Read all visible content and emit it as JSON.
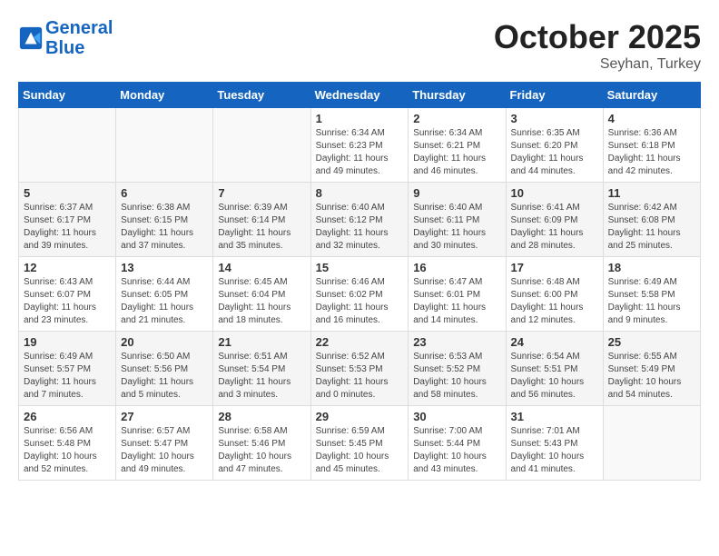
{
  "header": {
    "logo_line1": "General",
    "logo_line2": "Blue",
    "month_title": "October 2025",
    "location": "Seyhan, Turkey"
  },
  "weekdays": [
    "Sunday",
    "Monday",
    "Tuesday",
    "Wednesday",
    "Thursday",
    "Friday",
    "Saturday"
  ],
  "weeks": [
    [
      {
        "day": "",
        "info": ""
      },
      {
        "day": "",
        "info": ""
      },
      {
        "day": "",
        "info": ""
      },
      {
        "day": "1",
        "info": "Sunrise: 6:34 AM\nSunset: 6:23 PM\nDaylight: 11 hours\nand 49 minutes."
      },
      {
        "day": "2",
        "info": "Sunrise: 6:34 AM\nSunset: 6:21 PM\nDaylight: 11 hours\nand 46 minutes."
      },
      {
        "day": "3",
        "info": "Sunrise: 6:35 AM\nSunset: 6:20 PM\nDaylight: 11 hours\nand 44 minutes."
      },
      {
        "day": "4",
        "info": "Sunrise: 6:36 AM\nSunset: 6:18 PM\nDaylight: 11 hours\nand 42 minutes."
      }
    ],
    [
      {
        "day": "5",
        "info": "Sunrise: 6:37 AM\nSunset: 6:17 PM\nDaylight: 11 hours\nand 39 minutes."
      },
      {
        "day": "6",
        "info": "Sunrise: 6:38 AM\nSunset: 6:15 PM\nDaylight: 11 hours\nand 37 minutes."
      },
      {
        "day": "7",
        "info": "Sunrise: 6:39 AM\nSunset: 6:14 PM\nDaylight: 11 hours\nand 35 minutes."
      },
      {
        "day": "8",
        "info": "Sunrise: 6:40 AM\nSunset: 6:12 PM\nDaylight: 11 hours\nand 32 minutes."
      },
      {
        "day": "9",
        "info": "Sunrise: 6:40 AM\nSunset: 6:11 PM\nDaylight: 11 hours\nand 30 minutes."
      },
      {
        "day": "10",
        "info": "Sunrise: 6:41 AM\nSunset: 6:09 PM\nDaylight: 11 hours\nand 28 minutes."
      },
      {
        "day": "11",
        "info": "Sunrise: 6:42 AM\nSunset: 6:08 PM\nDaylight: 11 hours\nand 25 minutes."
      }
    ],
    [
      {
        "day": "12",
        "info": "Sunrise: 6:43 AM\nSunset: 6:07 PM\nDaylight: 11 hours\nand 23 minutes."
      },
      {
        "day": "13",
        "info": "Sunrise: 6:44 AM\nSunset: 6:05 PM\nDaylight: 11 hours\nand 21 minutes."
      },
      {
        "day": "14",
        "info": "Sunrise: 6:45 AM\nSunset: 6:04 PM\nDaylight: 11 hours\nand 18 minutes."
      },
      {
        "day": "15",
        "info": "Sunrise: 6:46 AM\nSunset: 6:02 PM\nDaylight: 11 hours\nand 16 minutes."
      },
      {
        "day": "16",
        "info": "Sunrise: 6:47 AM\nSunset: 6:01 PM\nDaylight: 11 hours\nand 14 minutes."
      },
      {
        "day": "17",
        "info": "Sunrise: 6:48 AM\nSunset: 6:00 PM\nDaylight: 11 hours\nand 12 minutes."
      },
      {
        "day": "18",
        "info": "Sunrise: 6:49 AM\nSunset: 5:58 PM\nDaylight: 11 hours\nand 9 minutes."
      }
    ],
    [
      {
        "day": "19",
        "info": "Sunrise: 6:49 AM\nSunset: 5:57 PM\nDaylight: 11 hours\nand 7 minutes."
      },
      {
        "day": "20",
        "info": "Sunrise: 6:50 AM\nSunset: 5:56 PM\nDaylight: 11 hours\nand 5 minutes."
      },
      {
        "day": "21",
        "info": "Sunrise: 6:51 AM\nSunset: 5:54 PM\nDaylight: 11 hours\nand 3 minutes."
      },
      {
        "day": "22",
        "info": "Sunrise: 6:52 AM\nSunset: 5:53 PM\nDaylight: 11 hours\nand 0 minutes."
      },
      {
        "day": "23",
        "info": "Sunrise: 6:53 AM\nSunset: 5:52 PM\nDaylight: 10 hours\nand 58 minutes."
      },
      {
        "day": "24",
        "info": "Sunrise: 6:54 AM\nSunset: 5:51 PM\nDaylight: 10 hours\nand 56 minutes."
      },
      {
        "day": "25",
        "info": "Sunrise: 6:55 AM\nSunset: 5:49 PM\nDaylight: 10 hours\nand 54 minutes."
      }
    ],
    [
      {
        "day": "26",
        "info": "Sunrise: 6:56 AM\nSunset: 5:48 PM\nDaylight: 10 hours\nand 52 minutes."
      },
      {
        "day": "27",
        "info": "Sunrise: 6:57 AM\nSunset: 5:47 PM\nDaylight: 10 hours\nand 49 minutes."
      },
      {
        "day": "28",
        "info": "Sunrise: 6:58 AM\nSunset: 5:46 PM\nDaylight: 10 hours\nand 47 minutes."
      },
      {
        "day": "29",
        "info": "Sunrise: 6:59 AM\nSunset: 5:45 PM\nDaylight: 10 hours\nand 45 minutes."
      },
      {
        "day": "30",
        "info": "Sunrise: 7:00 AM\nSunset: 5:44 PM\nDaylight: 10 hours\nand 43 minutes."
      },
      {
        "day": "31",
        "info": "Sunrise: 7:01 AM\nSunset: 5:43 PM\nDaylight: 10 hours\nand 41 minutes."
      },
      {
        "day": "",
        "info": ""
      }
    ]
  ]
}
